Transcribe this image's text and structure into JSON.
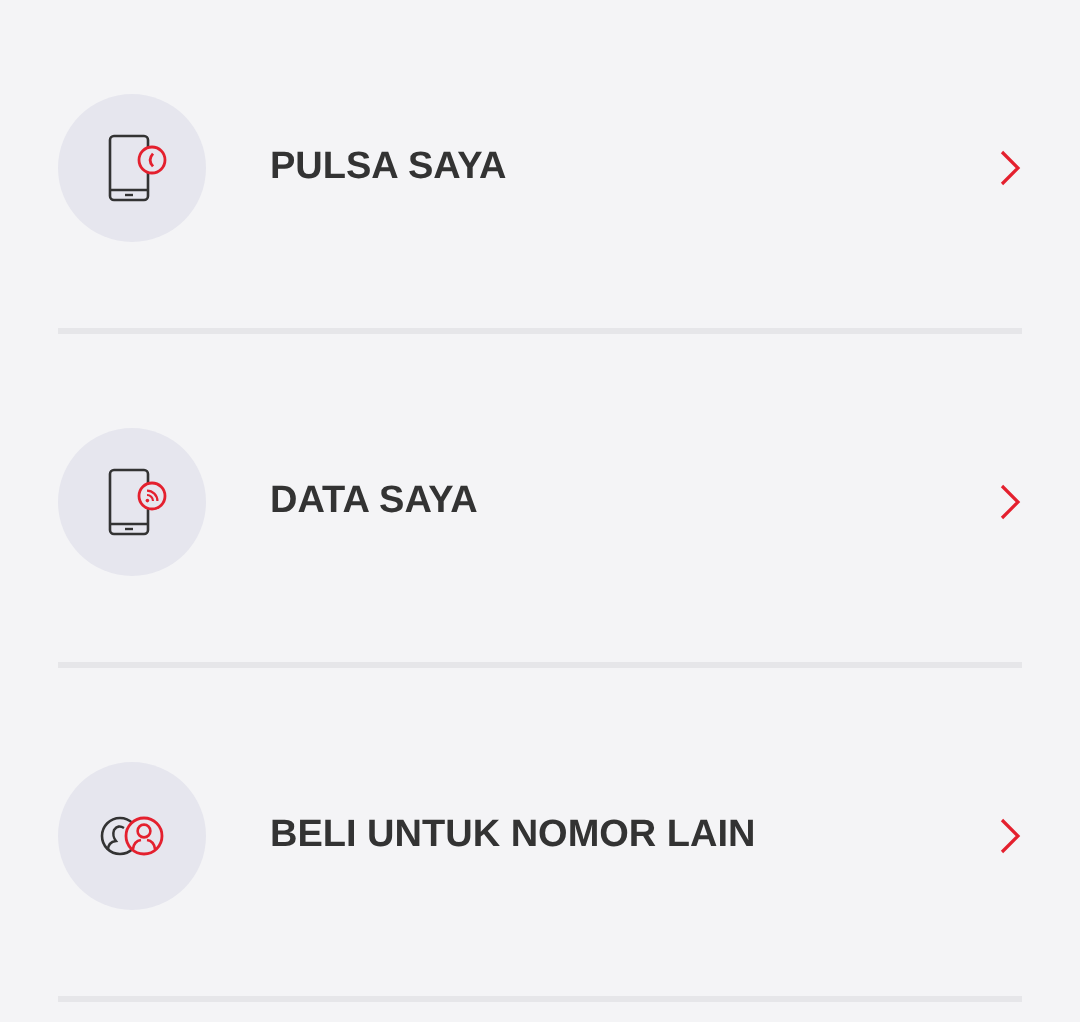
{
  "menu_items": [
    {
      "label": "PULSA SAYA",
      "kind": "phone-call"
    },
    {
      "label": "DATA SAYA",
      "kind": "phone-data"
    },
    {
      "label": "BELI UNTUK NOMOR LAIN",
      "kind": "people"
    }
  ]
}
